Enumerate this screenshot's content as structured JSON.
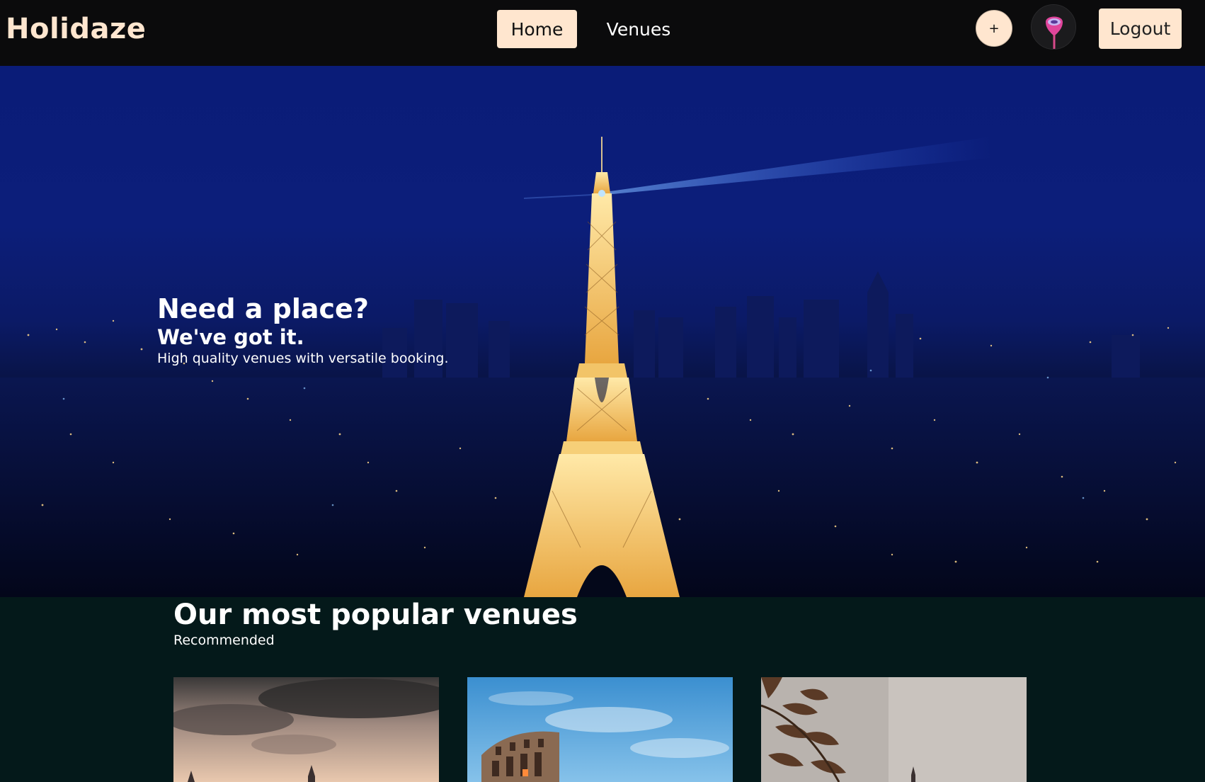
{
  "navbar": {
    "logo": "Holidaze",
    "links": [
      {
        "label": "Home",
        "active": true
      },
      {
        "label": "Venues",
        "active": false
      }
    ],
    "add_label": "+",
    "logout_label": "Logout"
  },
  "hero": {
    "title": "Need a place?",
    "subtitle": "We've got it.",
    "description": "High quality venues with versatile booking."
  },
  "popular": {
    "title": "Our most popular venues",
    "subtitle": "Recommended"
  },
  "colors": {
    "accent": "#ffe6cf",
    "navbar_bg": "#0b0b0c",
    "section_bg": "#04191a"
  }
}
